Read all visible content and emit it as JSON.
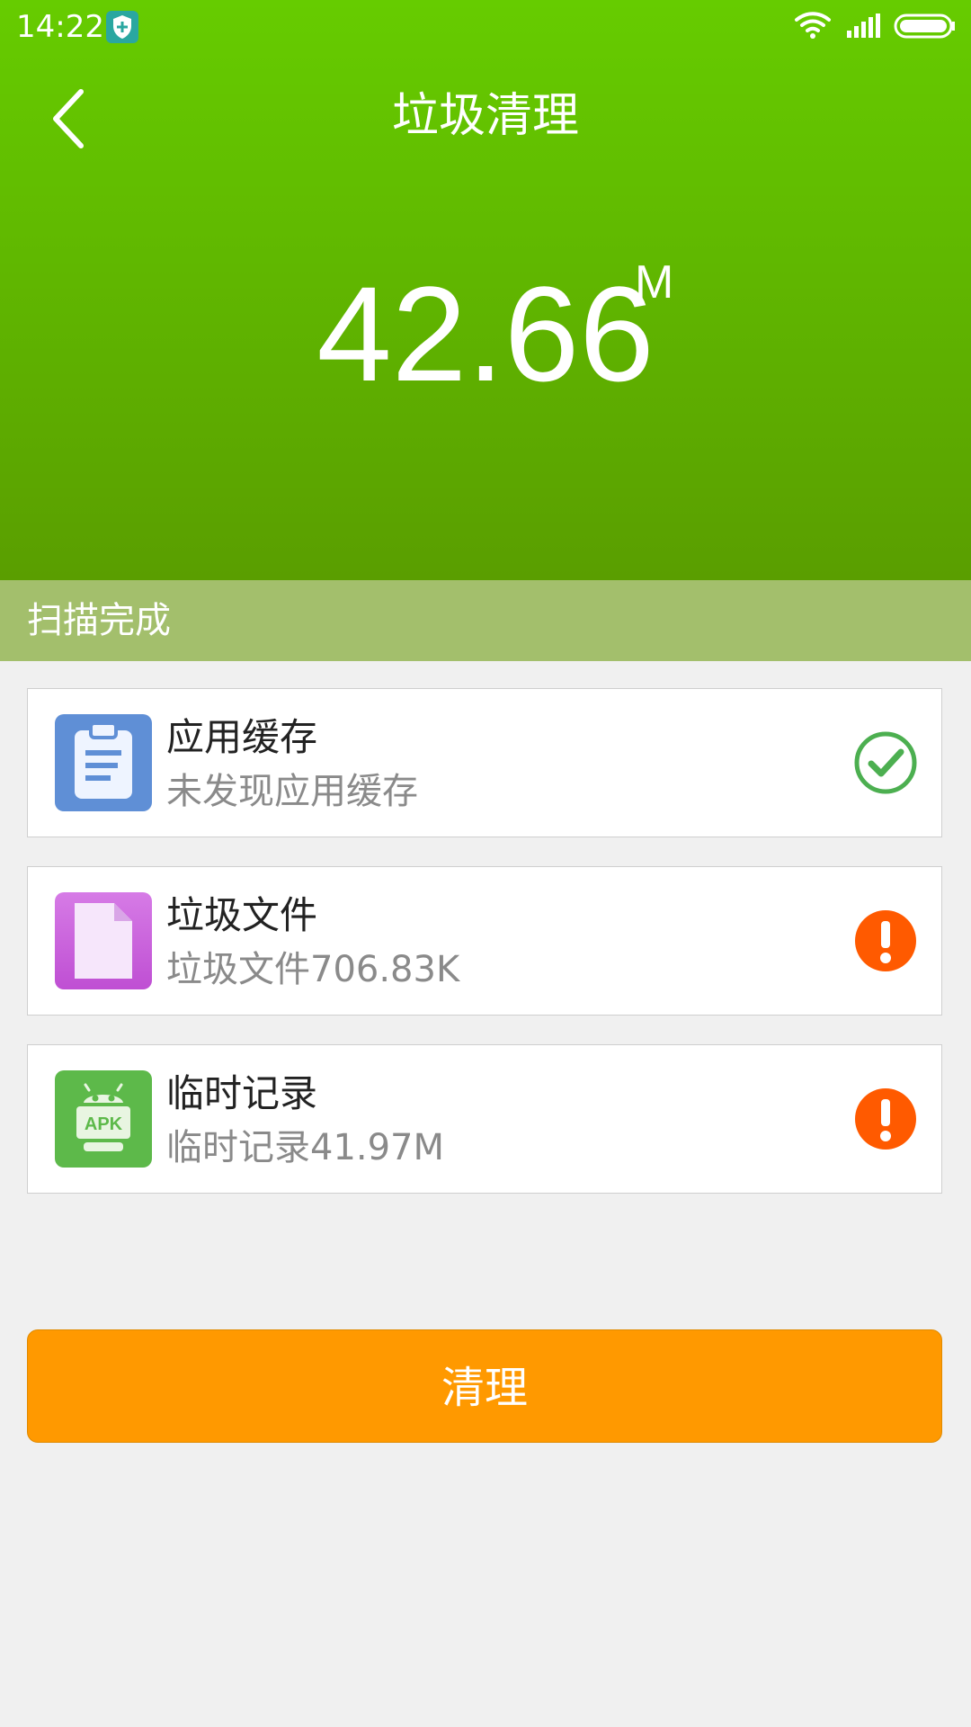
{
  "status_bar": {
    "time": "14:22",
    "icons": [
      "shield-icon",
      "wifi-icon",
      "signal-icon",
      "battery-icon"
    ]
  },
  "header": {
    "title": "垃圾清理",
    "back_icon": "back-chevron-icon"
  },
  "summary": {
    "size": "42.66",
    "unit": "M"
  },
  "scan_status": {
    "label": "扫描完成"
  },
  "items": [
    {
      "title": "应用缓存",
      "subtitle": "未发现应用缓存",
      "icon": "clipboard-icon",
      "status": "ok-check-icon",
      "icon_color": "#5f8fd6"
    },
    {
      "title": "垃圾文件",
      "subtitle": "垃圾文件706.83K",
      "icon": "document-icon",
      "status": "warning-icon",
      "icon_color": "#c85bd9"
    },
    {
      "title": "临时记录",
      "subtitle": "临时记录41.97M",
      "icon": "apk-android-icon",
      "status": "warning-icon",
      "icon_color": "#5db94a"
    }
  ],
  "actions": {
    "clean_label": "清理"
  },
  "colors": {
    "header_green": "#66cc00",
    "scan_bar": "#a3bf6c",
    "button_orange": "#ff9900",
    "warning_orange": "#ff5a00",
    "check_green": "#4caf50"
  }
}
